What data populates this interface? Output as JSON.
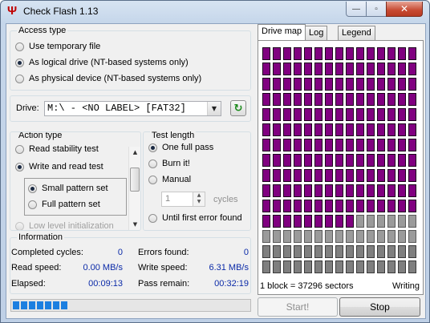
{
  "window": {
    "title": "Check Flash 1.13",
    "minimize": "—",
    "maximize": "▫",
    "close": "✕"
  },
  "access_type": {
    "legend": "Access type",
    "options": [
      {
        "label": "Use temporary file",
        "selected": false
      },
      {
        "label": "As logical drive (NT-based systems only)",
        "selected": true
      },
      {
        "label": "As physical device (NT-based systems only)",
        "selected": false
      }
    ]
  },
  "drive": {
    "label": "Drive:",
    "value": "M:\\ - <NO LABEL> [FAT32]"
  },
  "action_type": {
    "legend": "Action type",
    "options": [
      {
        "label": "Read stability test",
        "selected": false
      },
      {
        "label": "Write and read test",
        "selected": true
      },
      {
        "label": "Small pattern set",
        "selected": true
      },
      {
        "label": "Full pattern set",
        "selected": false
      },
      {
        "label": "Low level initialization",
        "selected": false
      }
    ]
  },
  "test_length": {
    "legend": "Test length",
    "options": [
      {
        "label": "One full pass",
        "selected": true
      },
      {
        "label": "Burn it!",
        "selected": false
      },
      {
        "label": "Manual",
        "selected": false
      },
      {
        "label": "Until first error found",
        "selected": false
      }
    ],
    "cycles_value": "1",
    "cycles_label": "cycles"
  },
  "information": {
    "legend": "Information",
    "completed_cycles_label": "Completed cycles:",
    "completed_cycles": "0",
    "errors_found_label": "Errors found:",
    "errors_found": "0",
    "read_speed_label": "Read speed:",
    "read_speed": "0.00 MB/s",
    "write_speed_label": "Write speed:",
    "write_speed": "6.31 MB/s",
    "elapsed_label": "Elapsed:",
    "elapsed": "00:09:13",
    "pass_remain_label": "Pass remain:",
    "pass_remain": "00:32:19"
  },
  "progress": {
    "segments": 7,
    "total_segments": 29
  },
  "tabs": [
    {
      "label": "Drive map",
      "active": true
    },
    {
      "label": "Log",
      "active": false
    },
    {
      "label": "Legend",
      "active": false
    }
  ],
  "drive_map": {
    "columns": 15,
    "rows": 15,
    "written_blocks": 174,
    "pending_blocks": 21,
    "empty_blocks": 30,
    "colors": {
      "written": "#800080",
      "pending": "#9b9b9b",
      "empty": "#7f7f7f"
    },
    "block_info": "1 block = 37296 sectors",
    "status": "Writing"
  },
  "buttons": {
    "start": "Start!",
    "stop": "Stop"
  }
}
